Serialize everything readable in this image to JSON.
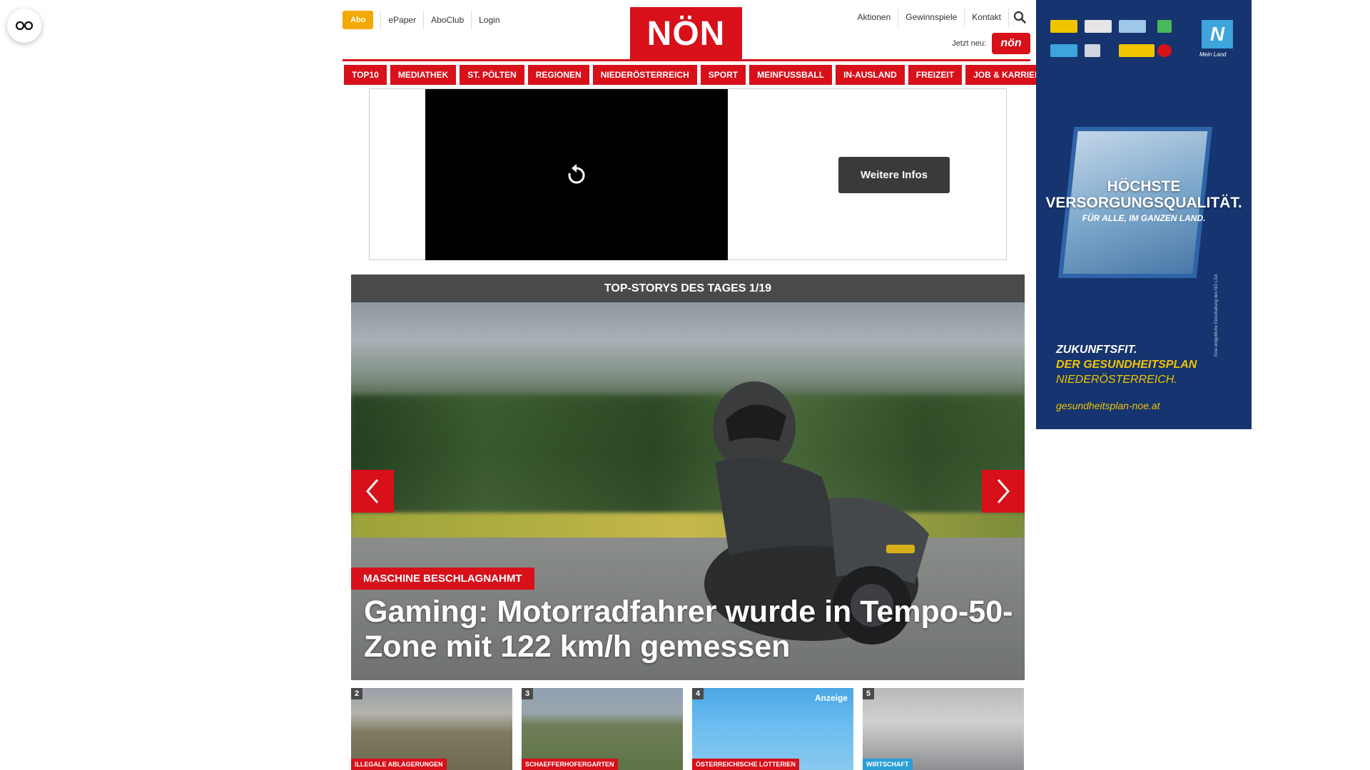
{
  "accessibility": {
    "icon": "glasses-icon"
  },
  "header": {
    "abo_label": "Abo",
    "links_left": [
      "ePaper",
      "AboClub",
      "Login"
    ],
    "logo_text": "NÖN",
    "links_right": [
      "Aktionen",
      "Gewinnspiele",
      "Kontakt"
    ],
    "search_icon": "search-icon",
    "jetzt_label": "Jetzt neu:",
    "jetzt_logo_text": "nön"
  },
  "mainnav": {
    "items": [
      "TOP10",
      "MEDIATHEK",
      "ST. PÖLTEN",
      "REGIONEN",
      "NIEDERÖSTERREICH",
      "SPORT",
      "MEINFUSSBALL",
      "IN-AUSLAND",
      "FREIZEIT",
      "JOB & KARRIERE"
    ]
  },
  "video_ad": {
    "replay_icon": "replay-icon",
    "button_label": "Weitere Infos"
  },
  "top_stories": {
    "header": "TOP-STORYS DES TAGES 1/19",
    "slide": {
      "tag": "MASCHINE BESCHLAGNAHMT",
      "title": "Gaming: Motorradfahrer wurde in Tempo-50-Zone mit 122 km/h gemessen"
    },
    "prev_icon": "chevron-left-icon",
    "next_icon": "chevron-right-icon"
  },
  "teasers": [
    {
      "num": "2",
      "tag": "ILLEGALE ABLAGERUNGEN",
      "tag_color": "#d7101a"
    },
    {
      "num": "3",
      "tag": "SCHAEFFERHOFERGARTEN",
      "tag_color": "#d7101a"
    },
    {
      "num": "4",
      "tag": "ÖSTERREICHISCHE LOTTERIEN",
      "anzeige": "Anzeige",
      "tag_color": "#d7101a"
    },
    {
      "num": "5",
      "tag": "WIRTSCHAFT",
      "tag_color": "#2a9fd6"
    }
  ],
  "side_ad": {
    "headline_line1": "HÖCHSTE",
    "headline_line2": "VERSORGUNGSQUALITÄT.",
    "sub": "FÜR ALLE, IM GANZEN LAND.",
    "claim1": "ZUKUNFTSFIT.",
    "claim2": "DER GESUNDHEITSPLAN",
    "claim3": "NIEDERÖSTERREICH.",
    "url": "gesundheitsplan-noe.at",
    "mein_land_label": "Mein Land",
    "vertical_text": "Eine entgeltliche Einschaltung des NÖ LGA"
  },
  "colors": {
    "brand_red": "#d7101a",
    "abo_yellow": "#f2a900",
    "ad_blue": "#16346f",
    "ad_yellow": "#f2c400"
  }
}
